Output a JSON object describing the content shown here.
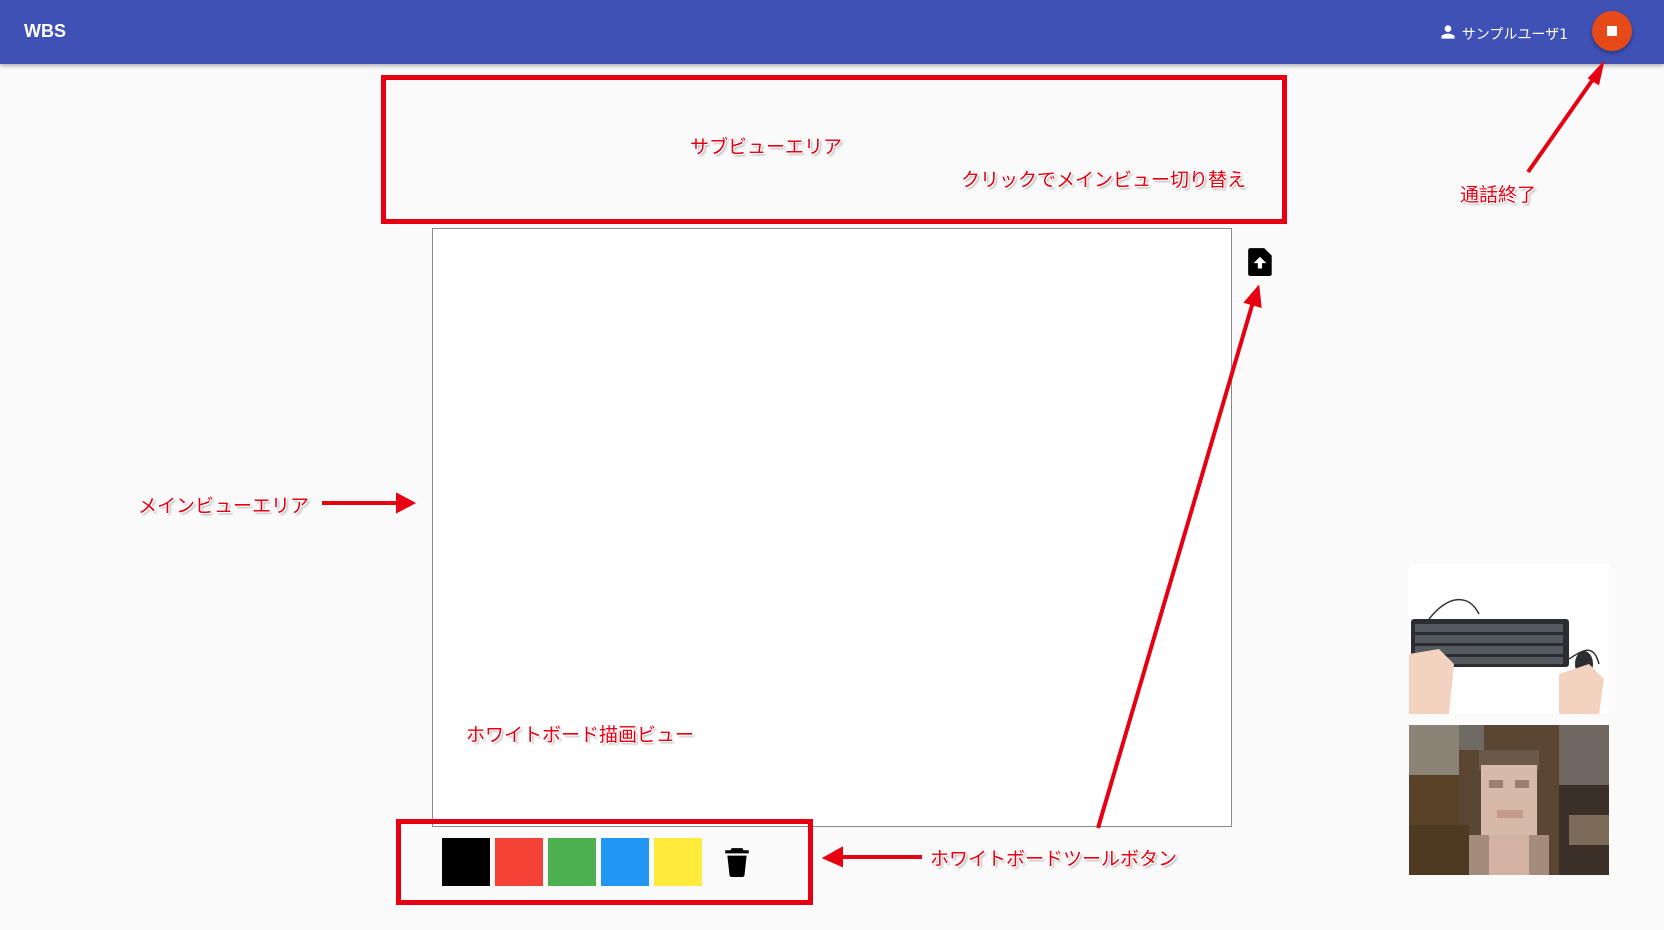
{
  "appbar": {
    "title": "WBS",
    "user_name": "サンプルユーザ1",
    "user_icon": "person-icon",
    "end_call_icon": "stop-icon",
    "color": "#3f51b5",
    "end_call_color": "#e64a19"
  },
  "annotations": {
    "sub_view": "サブビューエリア",
    "sub_view_hint": "クリックでメインビュー切り替え",
    "end_call": "通話終了",
    "main_view": "メインビューエリア",
    "whiteboard_view": "ホワイトボード描画ビュー",
    "toolbar": "ホワイトボードツールボタン",
    "color": "#e60012"
  },
  "main_view": {
    "upload_icon": "file-upload-icon"
  },
  "toolbar": {
    "swatches": [
      {
        "name": "black",
        "color": "#000000"
      },
      {
        "name": "red",
        "color": "#f44336"
      },
      {
        "name": "green",
        "color": "#4caf50"
      },
      {
        "name": "blue",
        "color": "#2196f3"
      },
      {
        "name": "yellow",
        "color": "#ffeb3b"
      }
    ],
    "trash_icon": "trash-icon"
  },
  "videos": [
    {
      "name": "keyboard-video"
    },
    {
      "name": "person-video"
    }
  ]
}
